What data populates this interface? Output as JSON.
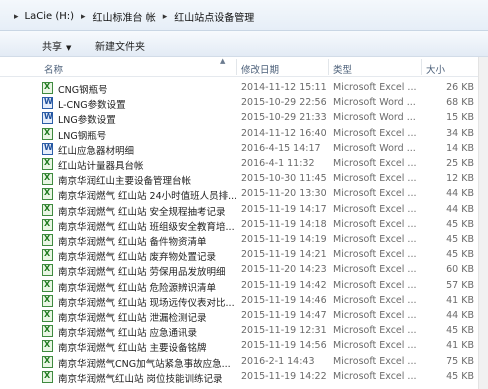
{
  "address": {
    "segments": [
      "LaCie (H:)",
      "红山标准台 帐",
      "红山站点设备管理"
    ]
  },
  "toolbar": {
    "share_label": "共享",
    "new_folder_label": "新建文件夹"
  },
  "columns": {
    "name": "名称",
    "date": "修改日期",
    "type": "类型",
    "size": "大小"
  },
  "files": [
    {
      "name": "CNG钢瓶号",
      "date": "2014-11-12 15:11",
      "type": "Microsoft Excel ...",
      "size": "26 KB",
      "icon": "excel"
    },
    {
      "name": "L-CNG参数设置",
      "date": "2015-10-29 22:56",
      "type": "Microsoft Word ...",
      "size": "68 KB",
      "icon": "word"
    },
    {
      "name": "LNG参数设置",
      "date": "2015-10-29 21:33",
      "type": "Microsoft Word ...",
      "size": "15 KB",
      "icon": "word"
    },
    {
      "name": "LNG钢瓶号",
      "date": "2014-11-12 16:40",
      "type": "Microsoft Excel ...",
      "size": "34 KB",
      "icon": "excel"
    },
    {
      "name": "红山应急器材明细",
      "date": "2016-4-15 14:17",
      "type": "Microsoft Word ...",
      "size": "14 KB",
      "icon": "word"
    },
    {
      "name": "红山站计量器具台帐",
      "date": "2016-4-1 11:32",
      "type": "Microsoft Excel ...",
      "size": "25 KB",
      "icon": "excel"
    },
    {
      "name": "南京华润红山主要设备管理台帐",
      "date": "2015-10-30 11:45",
      "type": "Microsoft Excel ...",
      "size": "12 KB",
      "icon": "excel"
    },
    {
      "name": "南京华润燃气 红山站 24小时值班人员排...",
      "date": "2015-11-20 13:30",
      "type": "Microsoft Excel ...",
      "size": "44 KB",
      "icon": "excel"
    },
    {
      "name": "南京华润燃气 红山站 安全规程抽考记录",
      "date": "2015-11-19 14:17",
      "type": "Microsoft Excel ...",
      "size": "44 KB",
      "icon": "excel"
    },
    {
      "name": "南京华润燃气 红山站 班组级安全教育培...",
      "date": "2015-11-19 14:18",
      "type": "Microsoft Excel ...",
      "size": "45 KB",
      "icon": "excel"
    },
    {
      "name": "南京华润燃气 红山站 备件物资清单",
      "date": "2015-11-19 14:19",
      "type": "Microsoft Excel ...",
      "size": "45 KB",
      "icon": "excel"
    },
    {
      "name": "南京华润燃气 红山站 废弃物处置记录",
      "date": "2015-11-19 14:21",
      "type": "Microsoft Excel ...",
      "size": "45 KB",
      "icon": "excel"
    },
    {
      "name": "南京华润燃气 红山站 劳保用品发放明细",
      "date": "2015-11-20 14:23",
      "type": "Microsoft Excel ...",
      "size": "60 KB",
      "icon": "excel"
    },
    {
      "name": "南京华润燃气 红山站 危险源辨识清单",
      "date": "2015-11-19 14:42",
      "type": "Microsoft Excel ...",
      "size": "57 KB",
      "icon": "excel"
    },
    {
      "name": "南京华润燃气 红山站 现场远传仪表对比...",
      "date": "2015-11-19 14:46",
      "type": "Microsoft Excel ...",
      "size": "41 KB",
      "icon": "excel"
    },
    {
      "name": "南京华润燃气 红山站 泄漏检测记录",
      "date": "2015-11-19 14:47",
      "type": "Microsoft Excel ...",
      "size": "44 KB",
      "icon": "excel"
    },
    {
      "name": "南京华润燃气 红山站 应急通讯录",
      "date": "2015-11-19 12:31",
      "type": "Microsoft Excel ...",
      "size": "45 KB",
      "icon": "excel"
    },
    {
      "name": "南京华润燃气 红山站 主要设备铭牌",
      "date": "2015-11-19 14:56",
      "type": "Microsoft Excel ...",
      "size": "41 KB",
      "icon": "excel"
    },
    {
      "name": "南京华润燃气CNG加气站紧急事故应急...",
      "date": "2016-2-1 14:43",
      "type": "Microsoft Excel ...",
      "size": "75 KB",
      "icon": "excel"
    },
    {
      "name": "南京华润燃气红山站 岗位技能训练记录",
      "date": "2015-11-19 14:22",
      "type": "Microsoft Excel ...",
      "size": "45 KB",
      "icon": "excel"
    }
  ]
}
